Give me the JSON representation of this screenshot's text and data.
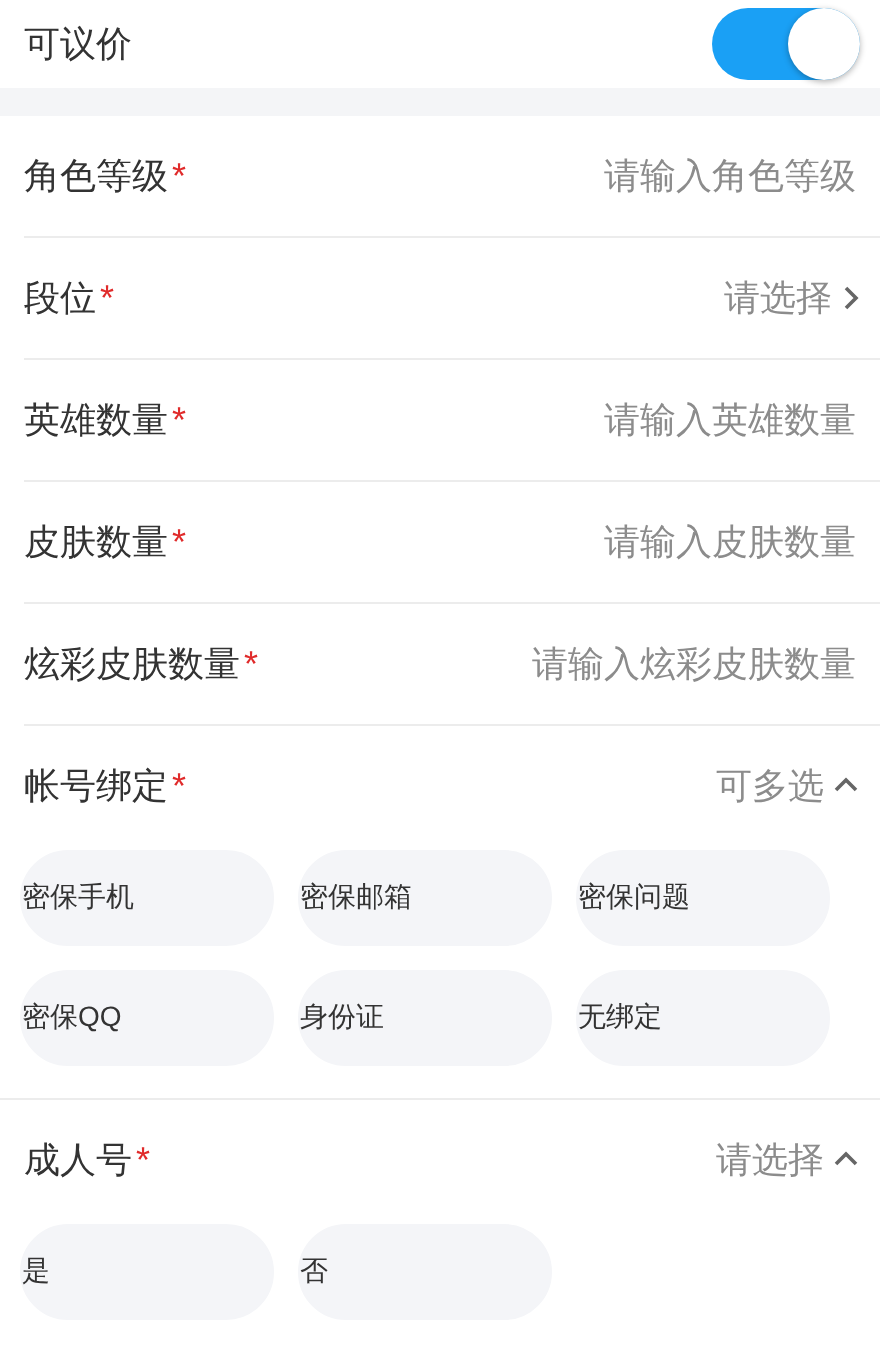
{
  "negotiable": {
    "label": "可议价",
    "on": true
  },
  "fields": [
    {
      "kind": "input",
      "label": "角色等级",
      "mark": "*",
      "placeholder": "请输入角色等级"
    },
    {
      "kind": "select",
      "label": "段位",
      "mark": "*",
      "value": "请选择"
    },
    {
      "kind": "input",
      "label": "英雄数量",
      "mark": "*",
      "placeholder": "请输入英雄数量"
    },
    {
      "kind": "input",
      "label": "皮肤数量",
      "mark": "*",
      "placeholder": "请输入皮肤数量"
    },
    {
      "kind": "input",
      "label": "炫彩皮肤数量",
      "mark": "*",
      "placeholder": "请输入炫彩皮肤数量"
    }
  ],
  "groups": [
    {
      "label": "帐号绑定",
      "mark": "*",
      "hint": "可多选",
      "expanded": true,
      "options": [
        {
          "label": "密保手机",
          "selected": false
        },
        {
          "label": "密保邮箱",
          "selected": false
        },
        {
          "label": "密保问题",
          "selected": false
        },
        {
          "label": "密保QQ",
          "selected": false
        },
        {
          "label": "身份证",
          "selected": false
        },
        {
          "label": "无绑定",
          "selected": false
        }
      ]
    },
    {
      "label": "成人号",
      "mark": "*",
      "hint": "请选择",
      "expanded": true,
      "options": [
        {
          "label": "是",
          "selected": false
        },
        {
          "label": "否",
          "selected": false
        }
      ]
    }
  ]
}
